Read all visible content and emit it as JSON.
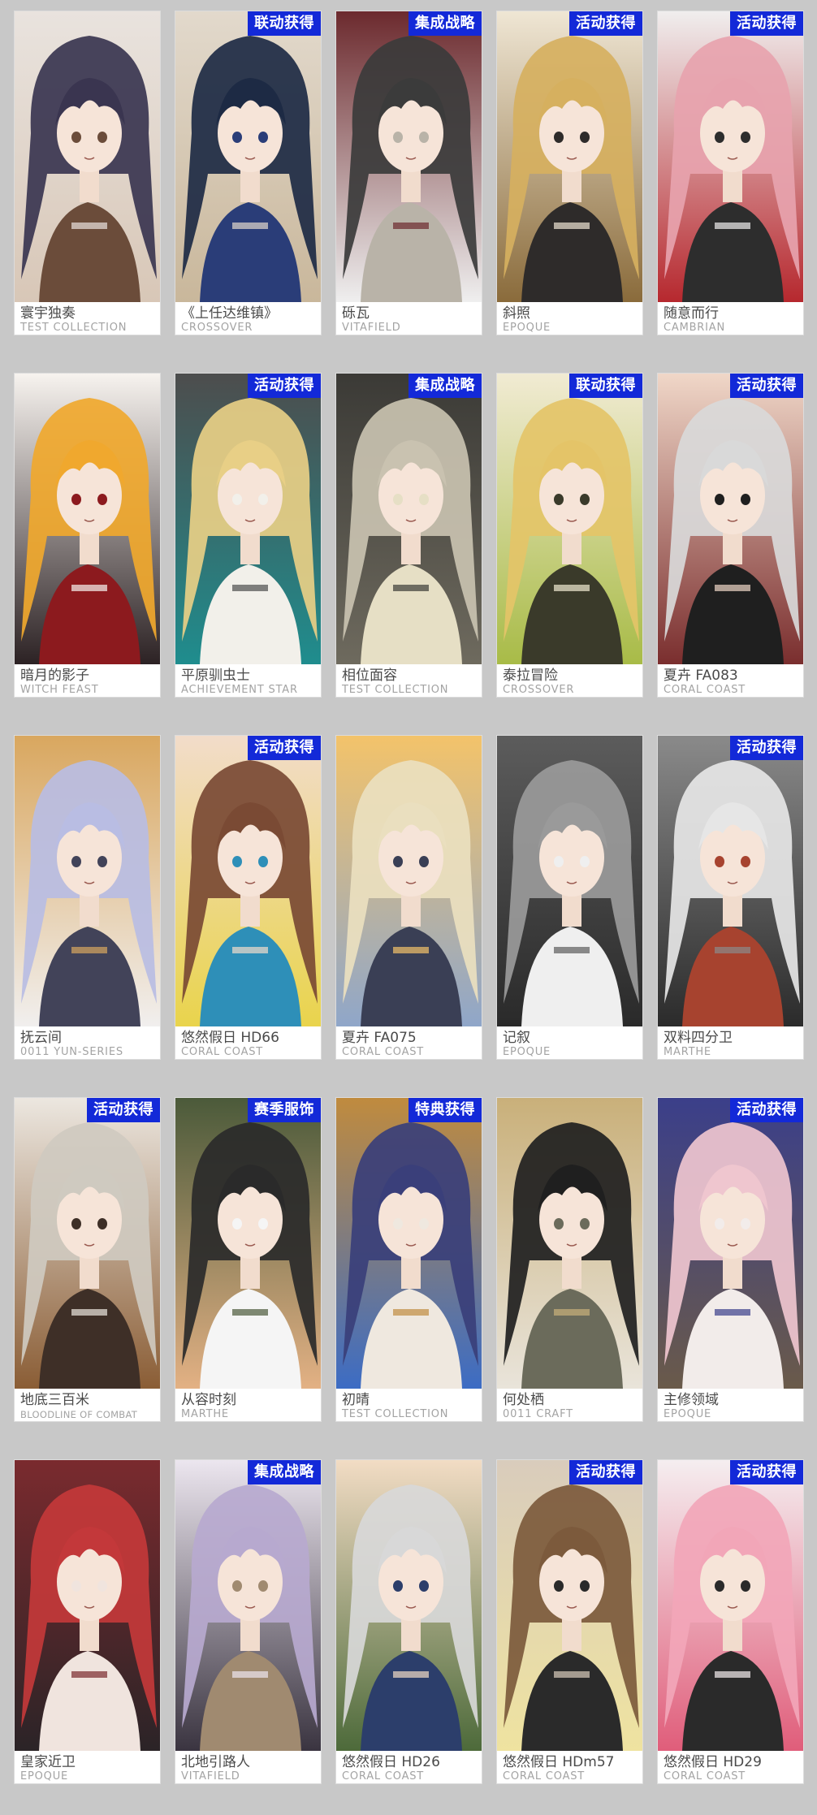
{
  "cards": [
    {
      "name": "寰宇独奏",
      "series": "TEST COLLECTION",
      "badge": "",
      "palette": [
        "#3a3550",
        "#d8c7b7",
        "#6b4c3a",
        "#e9e3de"
      ]
    },
    {
      "name": "《上任达维镇》",
      "series": "CROSSOVER",
      "badge": "联动获得",
      "palette": [
        "#1d2a44",
        "#c9b79b",
        "#2a3d78",
        "#e2d9cc"
      ]
    },
    {
      "name": "砾瓦",
      "series": "VITAFIELD",
      "badge": "集成战略",
      "palette": [
        "#3b3b3b",
        "#efefef",
        "#b9b3a8",
        "#6c2a2e"
      ]
    },
    {
      "name": "斜照",
      "series": "EPOQUE",
      "badge": "活动获得",
      "palette": [
        "#d6b05f",
        "#8a6b3b",
        "#2e2b2a",
        "#efe6d4"
      ]
    },
    {
      "name": "随意而行",
      "series": "CAMBRIAN",
      "badge": "活动获得",
      "palette": [
        "#e7a3ae",
        "#b6282e",
        "#2d2d2d",
        "#f0eeee"
      ]
    },
    {
      "name": "暗月的影子",
      "series": "WITCH FEAST",
      "badge": "",
      "palette": [
        "#f0a82e",
        "#2c2224",
        "#8c1a1e",
        "#f7f3ef"
      ]
    },
    {
      "name": "平原驯虫士",
      "series": "ACHIEVEMENT STAR",
      "badge": "活动获得",
      "palette": [
        "#e8cf86",
        "#1f8d8e",
        "#f2f0ea",
        "#4d4d4d"
      ]
    },
    {
      "name": "相位面容",
      "series": "TEST COLLECTION",
      "badge": "集成战略",
      "palette": [
        "#c9c2b0",
        "#6e6a5e",
        "#e6dfc5",
        "#3b3a36"
      ]
    },
    {
      "name": "泰拉冒险",
      "series": "CROSSOVER",
      "badge": "联动获得",
      "palette": [
        "#e4c468",
        "#a8bb47",
        "#3a3a2a",
        "#f1ebd3"
      ]
    },
    {
      "name": "夏卉 FA083",
      "series": "CORAL COAST",
      "badge": "活动获得",
      "palette": [
        "#d9d9d9",
        "#7a2e2e",
        "#1f1f1f",
        "#f0d7c8"
      ]
    },
    {
      "name": "抚云间",
      "series": "0011 YUN-SERIES",
      "badge": "",
      "palette": [
        "#b9bde3",
        "#f1efee",
        "#424359",
        "#d9a75f"
      ]
    },
    {
      "name": "悠然假日 HD66",
      "series": "CORAL COAST",
      "badge": "活动获得",
      "palette": [
        "#7a4a34",
        "#e9d44c",
        "#2e8fb8",
        "#f2dcca"
      ]
    },
    {
      "name": "夏卉 FA075",
      "series": "CORAL COAST",
      "badge": "",
      "palette": [
        "#eadfbf",
        "#8fa6c9",
        "#3a3f55",
        "#f3c36a"
      ]
    },
    {
      "name": "记叙",
      "series": "EPOQUE",
      "badge": "",
      "palette": [
        "#9a9a9a",
        "#2a2a2a",
        "#efefef",
        "#5c5c5c"
      ]
    },
    {
      "name": "双料四分卫",
      "series": "MARTHE",
      "badge": "活动获得",
      "palette": [
        "#e6e6e6",
        "#2b2b2b",
        "#a7432f",
        "#8a8a8a"
      ]
    },
    {
      "name": "地底三百米",
      "series": "BLOODLINE OF COMBAT",
      "badge": "活动获得",
      "palette": [
        "#cfcac0",
        "#8a5d35",
        "#3e2f27",
        "#ece7e0"
      ]
    },
    {
      "name": "从容时刻",
      "series": "MARTHE",
      "badge": "赛季服饰",
      "palette": [
        "#2a2a2a",
        "#e3b184",
        "#f5f5f5",
        "#4b5a3a"
      ]
    },
    {
      "name": "初晴",
      "series": "TEST COLLECTION",
      "badge": "特典获得",
      "palette": [
        "#3a3f7a",
        "#3c6cc4",
        "#efe8df",
        "#c08b3e"
      ]
    },
    {
      "name": "何处栖",
      "series": "0011 CRAFT",
      "badge": "",
      "palette": [
        "#1f1f1f",
        "#e9e4da",
        "#6b6b5b",
        "#c9b07a"
      ]
    },
    {
      "name": "主修领域",
      "series": "EPOQUE",
      "badge": "活动获得",
      "palette": [
        "#efc6cf",
        "#6a5a4a",
        "#f2ecea",
        "#3b3f8a"
      ]
    },
    {
      "name": "皇家近卫",
      "series": "EPOQUE",
      "badge": "",
      "palette": [
        "#c3383a",
        "#2b2427",
        "#f0e4de",
        "#7a2a2e"
      ]
    },
    {
      "name": "北地引路人",
      "series": "VITAFIELD",
      "badge": "集成战略",
      "palette": [
        "#b7a9cf",
        "#3a3440",
        "#a08a70",
        "#ece6ef"
      ]
    },
    {
      "name": "悠然假日 HD26",
      "series": "CORAL COAST",
      "badge": "",
      "palette": [
        "#d8d8d8",
        "#4d6a3a",
        "#2c3e6b",
        "#f2dcc4"
      ]
    },
    {
      "name": "悠然假日 HDm57",
      "series": "CORAL COAST",
      "badge": "活动获得",
      "palette": [
        "#7c5a3c",
        "#efe3a0",
        "#2a2a2a",
        "#d9ccbc"
      ]
    },
    {
      "name": "悠然假日 HD29",
      "series": "CORAL COAST",
      "badge": "活动获得",
      "palette": [
        "#f2a6b8",
        "#e05d7a",
        "#2a2a2a",
        "#f5eef0"
      ]
    }
  ]
}
